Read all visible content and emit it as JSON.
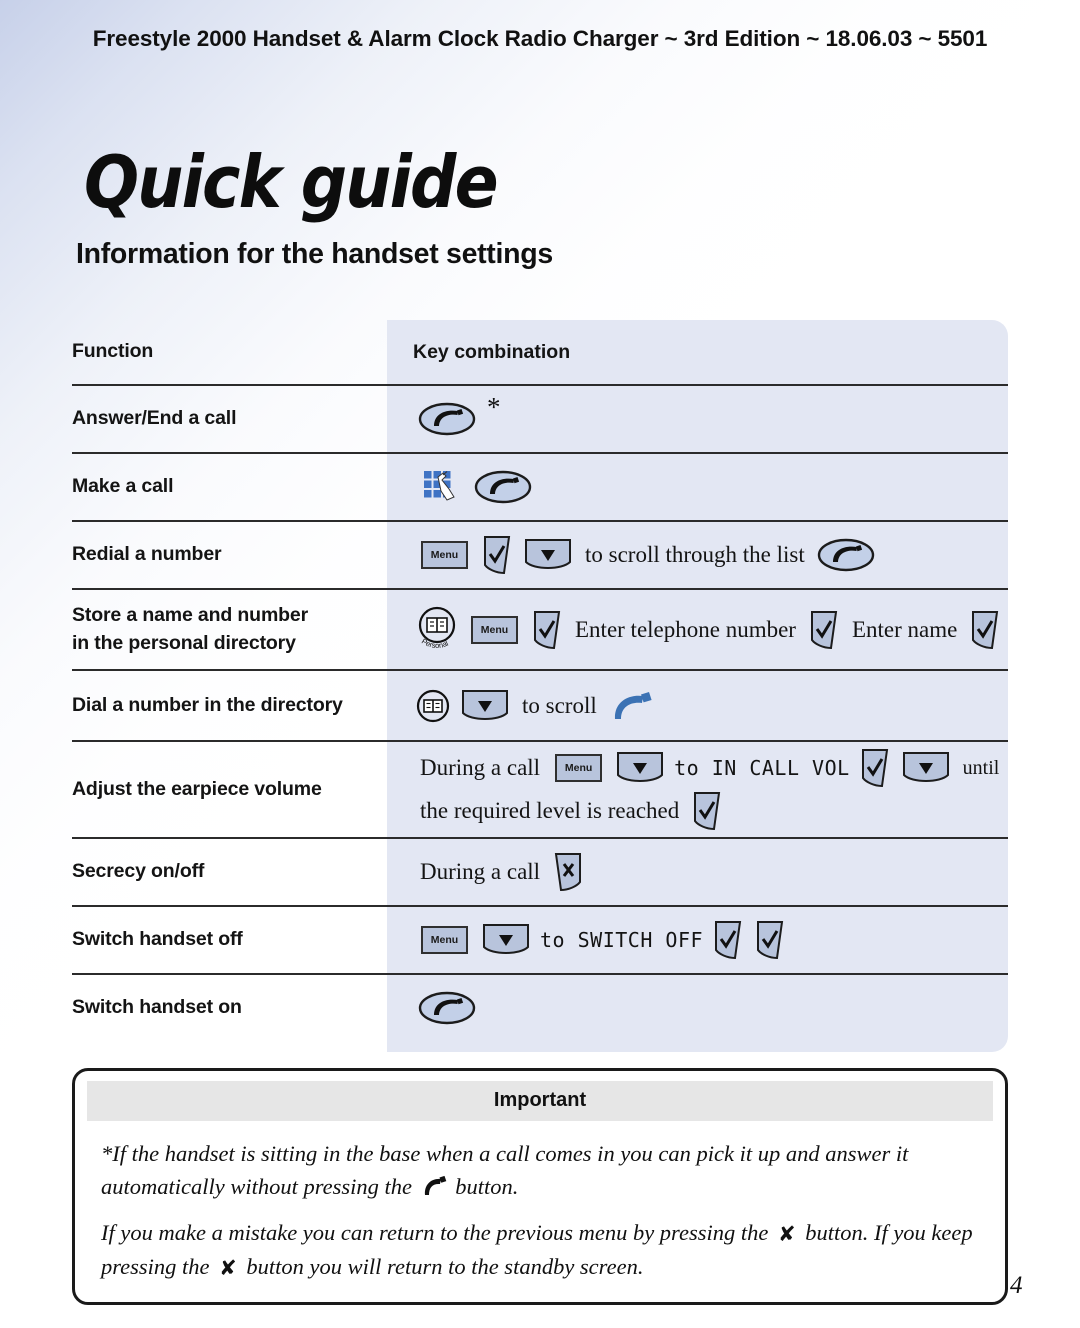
{
  "header": {
    "running_head": "Freestyle 2000 Handset & Alarm Clock Radio Charger  ~ 3rd Edition ~ 18.06.03 ~ 5501"
  },
  "title": "Quick guide",
  "subtitle": "Information for the handset settings",
  "table": {
    "columns": {
      "function": "Function",
      "key_combination": "Key combination"
    },
    "rows": [
      {
        "function": "Answer/End a call",
        "keys": [
          "phone-oval-button",
          "asterisk"
        ]
      },
      {
        "function": "Make a call",
        "keys": [
          "keypad-icon",
          "phone-oval-button"
        ]
      },
      {
        "function": "Redial a number",
        "keys": [
          "menu-key",
          "check-key",
          "down-arrow-key"
        ],
        "text_1": "to scroll through the list",
        "trailing_key": "phone-oval-button"
      },
      {
        "function_line_1": "Store a name and number",
        "function_line_2": "in the personal directory",
        "personal_label": "Personal",
        "text_1": "Enter telephone number",
        "text_2": "Enter name"
      },
      {
        "function": "Dial a number in the directory",
        "text_1": "to scroll"
      },
      {
        "function": "Adjust the earpiece volume",
        "text_1": "During a call",
        "lcd_1": "to IN CALL VOL",
        "text_2": "until",
        "text_3": "the required level is reached"
      },
      {
        "function": "Secrecy on/off",
        "text_1": "During a call"
      },
      {
        "function": "Switch handset off",
        "lcd_1": "to SWITCH OFF"
      },
      {
        "function": "Switch handset on",
        "keys": [
          "phone-oval-button"
        ]
      }
    ],
    "menu_key_label": "Menu"
  },
  "important": {
    "heading": "Important",
    "paragraph_1_part_1": "*If the handset is sitting in the base when a call comes in you can pick it up and answer it automatically without pressing the",
    "paragraph_1_part_2": "button.",
    "paragraph_2_part_1": "If you make a mistake you can return to the previous menu by pressing the",
    "paragraph_2_part_2": "button. If you keep pressing the",
    "paragraph_2_part_3": "button you will return to the standby screen.",
    "x_glyph": "✘"
  },
  "page_number": "4",
  "colors": {
    "key_fill": "#b8c4dc",
    "key_column_bg": "#e3e7f3",
    "rule": "#2b2b2b",
    "important_band": "#e6e6e6",
    "phone_blue": "#3b72b4"
  }
}
